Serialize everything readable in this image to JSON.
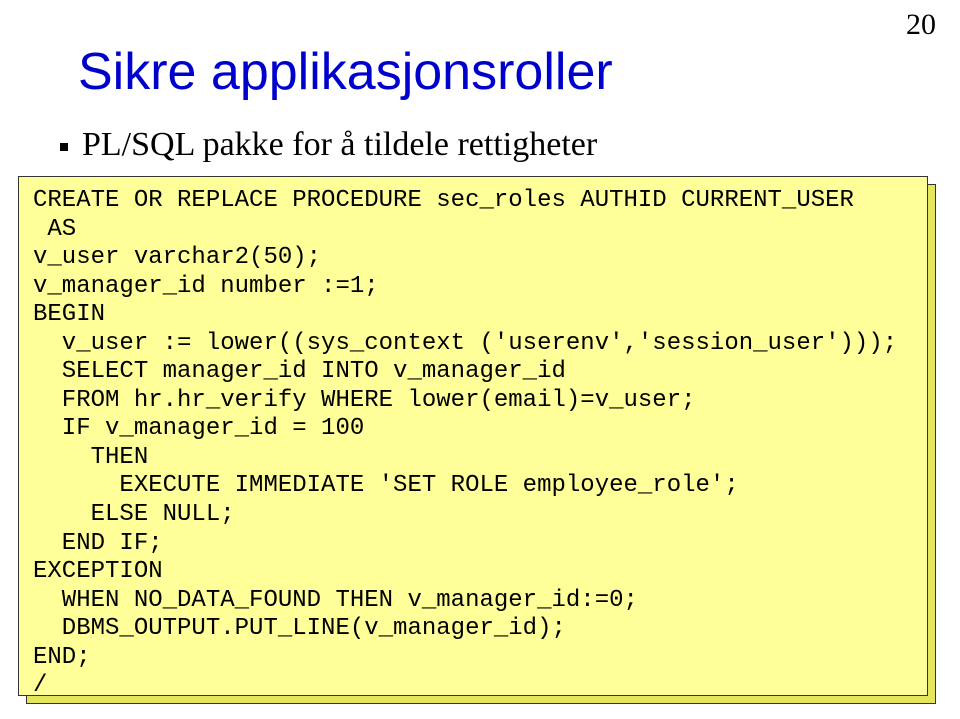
{
  "page_number": "20",
  "title": "Sikre applikasjonsroller",
  "bullet": "PL/SQL pakke for å tildele rettigheter",
  "code": {
    "l1": "CREATE OR REPLACE PROCEDURE sec_roles AUTHID CURRENT_USER",
    "l2": " AS",
    "l3": "v_user varchar2(50);",
    "l4": "v_manager_id number :=1;",
    "l5": "BEGIN",
    "l6": "  v_user := lower((sys_context ('userenv','session_user')));",
    "l7": "  SELECT manager_id INTO v_manager_id",
    "l8": "  FROM hr.hr_verify WHERE lower(email)=v_user;",
    "l9": "  IF v_manager_id = 100",
    "l10": "    THEN",
    "l11": "      EXECUTE IMMEDIATE 'SET ROLE employee_role';",
    "l12": "    ELSE NULL;",
    "l13": "  END IF;",
    "l14": "EXCEPTION",
    "l15": "  WHEN NO_DATA_FOUND THEN v_manager_id:=0;",
    "l16": "  DBMS_OUTPUT.PUT_LINE(v_manager_id);",
    "l17": "END;",
    "l18": "/"
  }
}
